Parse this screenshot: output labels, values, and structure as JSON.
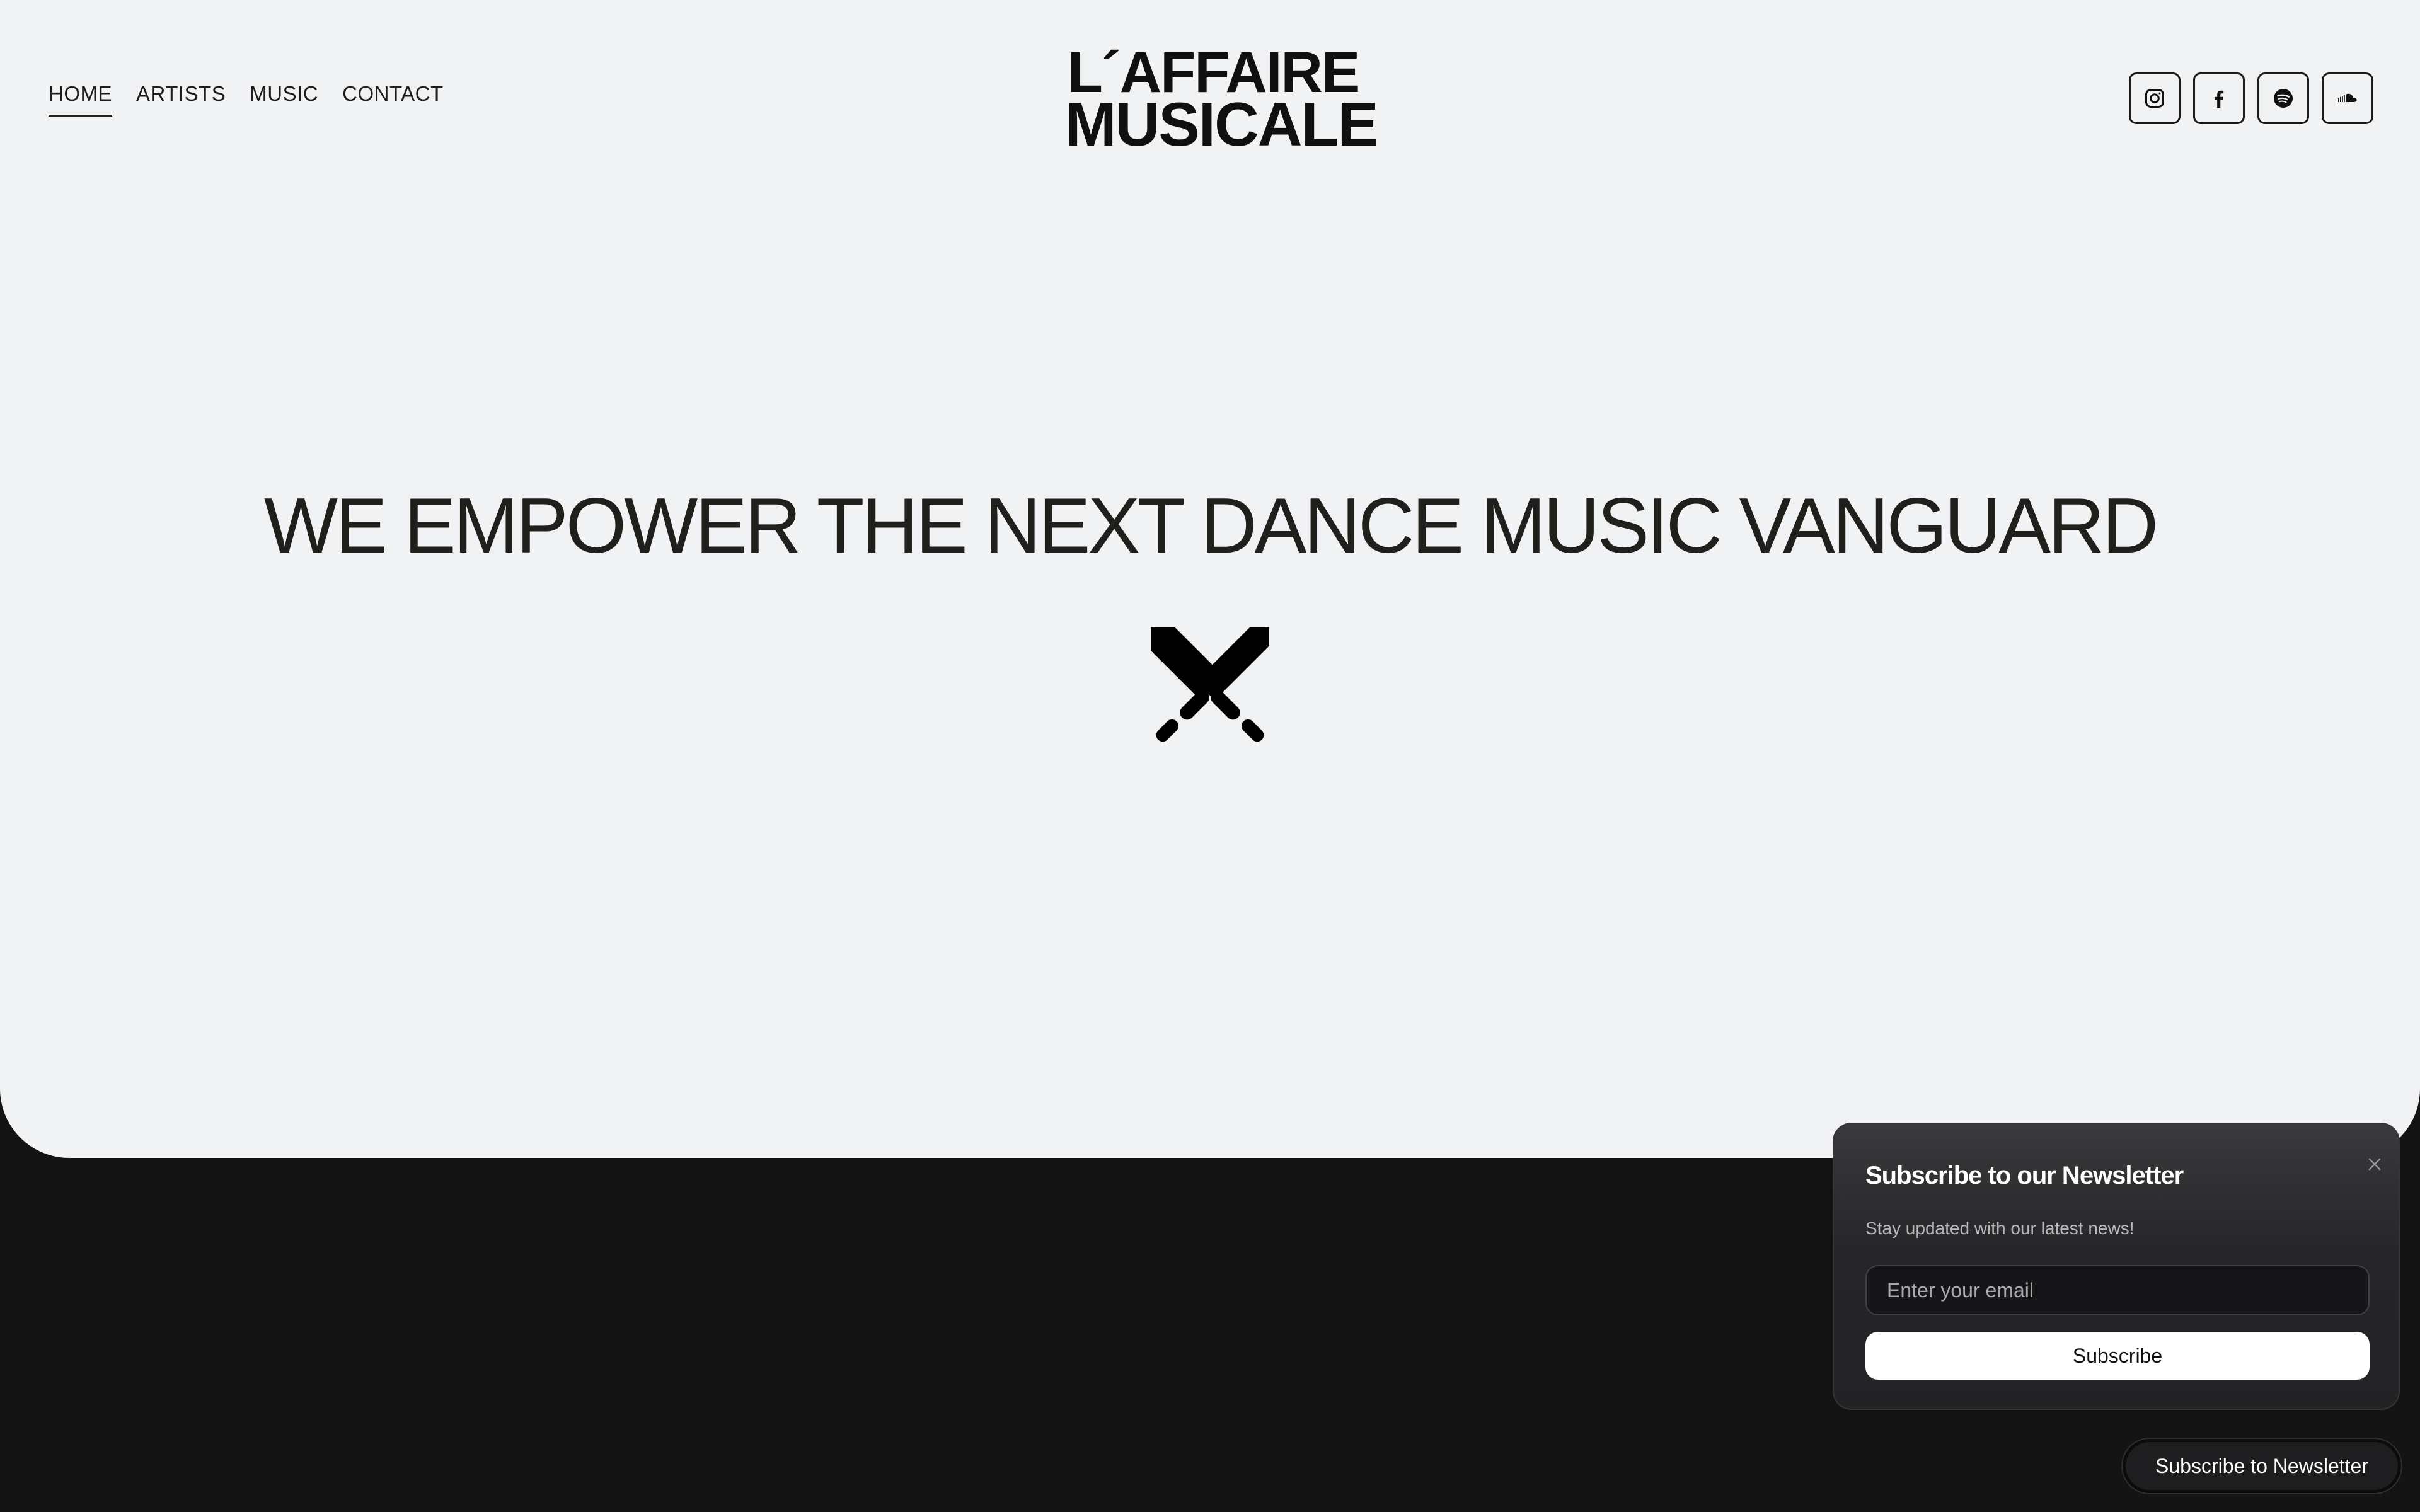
{
  "nav": {
    "items": [
      {
        "label": "HOME",
        "active": true
      },
      {
        "label": "ARTISTS",
        "active": false
      },
      {
        "label": "MUSIC",
        "active": false
      },
      {
        "label": "CONTACT",
        "active": false
      }
    ]
  },
  "logo": {
    "line1": "L´AFFAIRE",
    "line2": "MUSICALE"
  },
  "socials": {
    "icons": [
      "instagram-icon",
      "facebook-icon",
      "spotify-icon",
      "soundcloud-icon"
    ]
  },
  "hero": {
    "headline": "WE EMPOWER THE NEXT DANCE MUSIC VANGUARD",
    "emblem_icon": "crossed-swords-icon"
  },
  "newsletter_popup": {
    "title": "Subscribe to our Newsletter",
    "subtitle": "Stay updated with our latest news!",
    "email_placeholder": "Enter your email",
    "email_value": "",
    "submit_label": "Subscribe",
    "close_icon": "close-icon"
  },
  "floating_button": {
    "label": "Subscribe to Newsletter"
  },
  "colors": {
    "hero_background": "#f1f2f4",
    "page_background": "#141414",
    "text_dark": "#1f201c",
    "popup_background": "#262628",
    "button_white": "#ffffff"
  }
}
